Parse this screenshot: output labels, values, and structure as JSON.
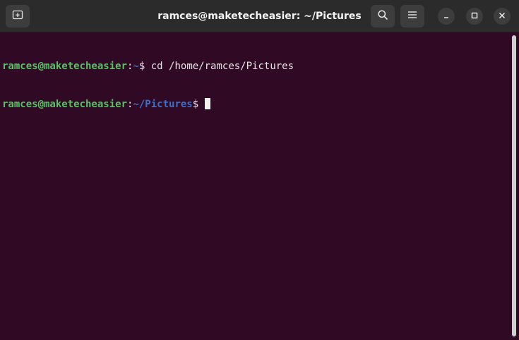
{
  "window": {
    "title": "ramces@maketecheasier: ~/Pictures"
  },
  "headerbar": {
    "new_tab_icon": "new-tab-icon",
    "search_icon": "search-icon",
    "menu_icon": "hamburger-menu-icon",
    "minimize_icon": "minimize-icon",
    "maximize_icon": "maximize-icon",
    "close_icon": "close-icon"
  },
  "terminal": {
    "lines": [
      {
        "user_host": "ramces@maketecheasier",
        "colon": ":",
        "path": "~",
        "prompt_end": "$ ",
        "command": "cd /home/ramces/Pictures"
      },
      {
        "user_host": "ramces@maketecheasier",
        "colon": ":",
        "path": "~/Pictures",
        "prompt_end": "$ ",
        "command": ""
      }
    ]
  },
  "colors": {
    "terminal_background": "#300a24",
    "user_host": "#58c267",
    "path": "#3f6fc9",
    "headerbar": "#2b2b2b"
  }
}
